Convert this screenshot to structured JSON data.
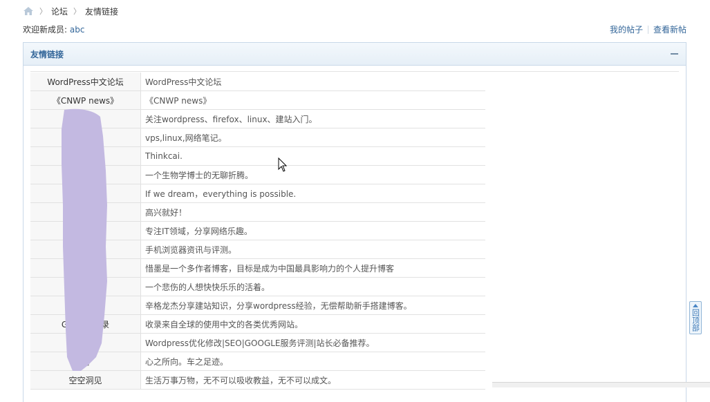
{
  "breadcrumb": {
    "home_icon": "home-icon",
    "separator": "〉",
    "items": [
      "论坛",
      "友情链接"
    ]
  },
  "welcome": {
    "prefix": "欢迎新成员: ",
    "username": "abc"
  },
  "toplinks": {
    "my_posts": "我的帖子",
    "new_posts": "查看新帖"
  },
  "panel": {
    "title": "友情链接",
    "collapse_icon": "minus-icon"
  },
  "links": [
    {
      "name": "WordPress中文论坛",
      "desc": "WordPress中文论坛"
    },
    {
      "name": "《CNWP news》",
      "desc": "《CNWP news》"
    },
    {
      "name": "客",
      "desc": "关注wordpress、firefox、linux、建站入门。"
    },
    {
      "name": "",
      "desc": "vps,linux,网络笔记。"
    },
    {
      "name": "",
      "desc": "Thinkcai."
    },
    {
      "name": "",
      "desc": "一个生物学博士的无聊折腾。"
    },
    {
      "name": "L                  g",
      "desc": "If we dream，everything is possible."
    },
    {
      "name": "",
      "desc": "高兴就好！"
    },
    {
      "name": "",
      "desc": "专注IT领域，分享网络乐趣。"
    },
    {
      "name": "",
      "desc": "手机浏览器资讯与评测。"
    },
    {
      "name": "",
      "desc": "惜墨是一个多作者博客，目标是成为中国最具影响力的个人提升博客"
    },
    {
      "name": "",
      "desc": "一个悲伤的人想快快乐乐的活着。"
    },
    {
      "name": "",
      "desc": "辛格龙杰分享建站知识，分享wordpress经验，无偿帮助新手搭建博客。"
    },
    {
      "name": "Gttol全            目录",
      "desc": "收录来自全球的使用中文的各类优秀网站。"
    },
    {
      "name": "电           客",
      "desc": "Wordpress优化修改|SEO|GOOGLE服务评测|站长必备推荐。"
    },
    {
      "name": "间",
      "desc": "心之所向。车之足迹。"
    },
    {
      "name": "空空洞见",
      "desc": "生活万事万物，无不可以吸收教益，无不可以成文。"
    }
  ],
  "back_to_top": {
    "label": "回顶部",
    "icon": "up-arrow-icon"
  },
  "colors": {
    "link": "#336699",
    "panel_border": "#c8d8e8",
    "scribble": "#c3b9e1"
  }
}
